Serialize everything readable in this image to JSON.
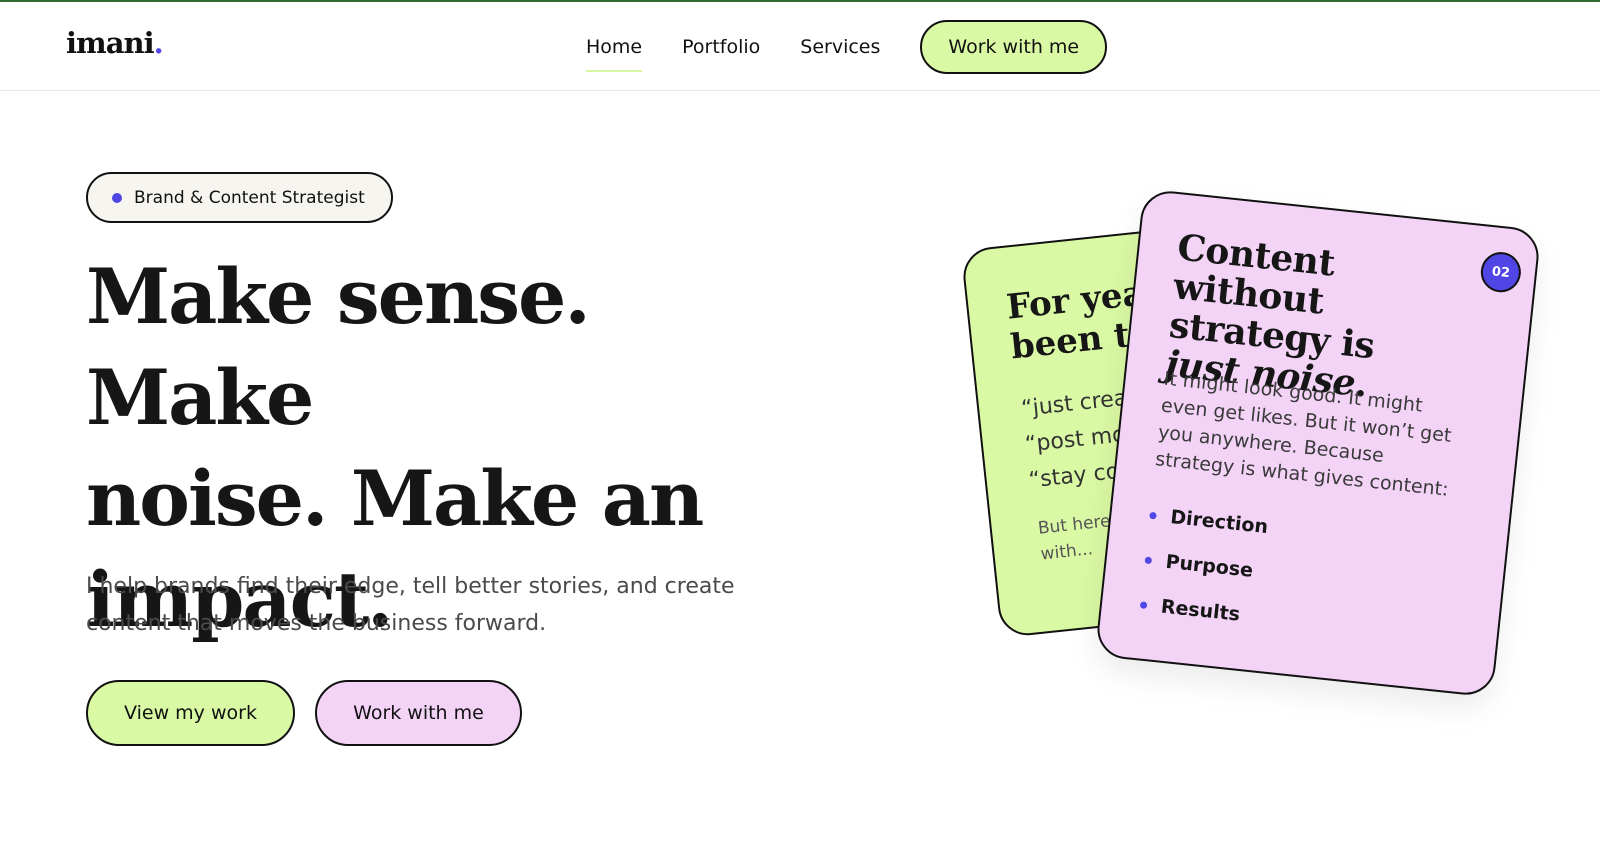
{
  "brand": {
    "name": "imani",
    "dot": ".",
    "accent": "#4f46e5"
  },
  "nav": {
    "links": [
      {
        "label": "Home",
        "active": true
      },
      {
        "label": "Portfolio",
        "active": false
      },
      {
        "label": "Services",
        "active": false
      }
    ],
    "cta": "Work with me"
  },
  "hero": {
    "badge": "Brand & Content Strategist",
    "headline_line1": "Make sense. Make",
    "headline_line2": "noise. Make an",
    "headline_line3": "impact.",
    "subtext": "I help brands find their edge, tell better stories, and create content that moves the business forward.",
    "primary_button": "View my work",
    "secondary_button": "Work with me"
  },
  "cards": {
    "green": {
      "title_line1": "For years",
      "title_line2": "been told",
      "quote1": "“just create",
      "quote2": "“post more",
      "quote3": "“stay cons",
      "footer": "But here’s what I’ve ended up with..."
    },
    "pink": {
      "number": "02",
      "title_part1": "Content without strategy is",
      "title_italic": "just noise",
      "title_end": ".",
      "body": "It might look good. It might even get likes. But it won’t get you anywhere. Because strategy is what gives content:",
      "bullets": [
        "Direction",
        "Purpose",
        "Results"
      ]
    }
  },
  "colors": {
    "green": "#daf9a4",
    "pink": "#f3d4f7",
    "indigo": "#4f46e5",
    "topline": "#2f6b2f"
  }
}
